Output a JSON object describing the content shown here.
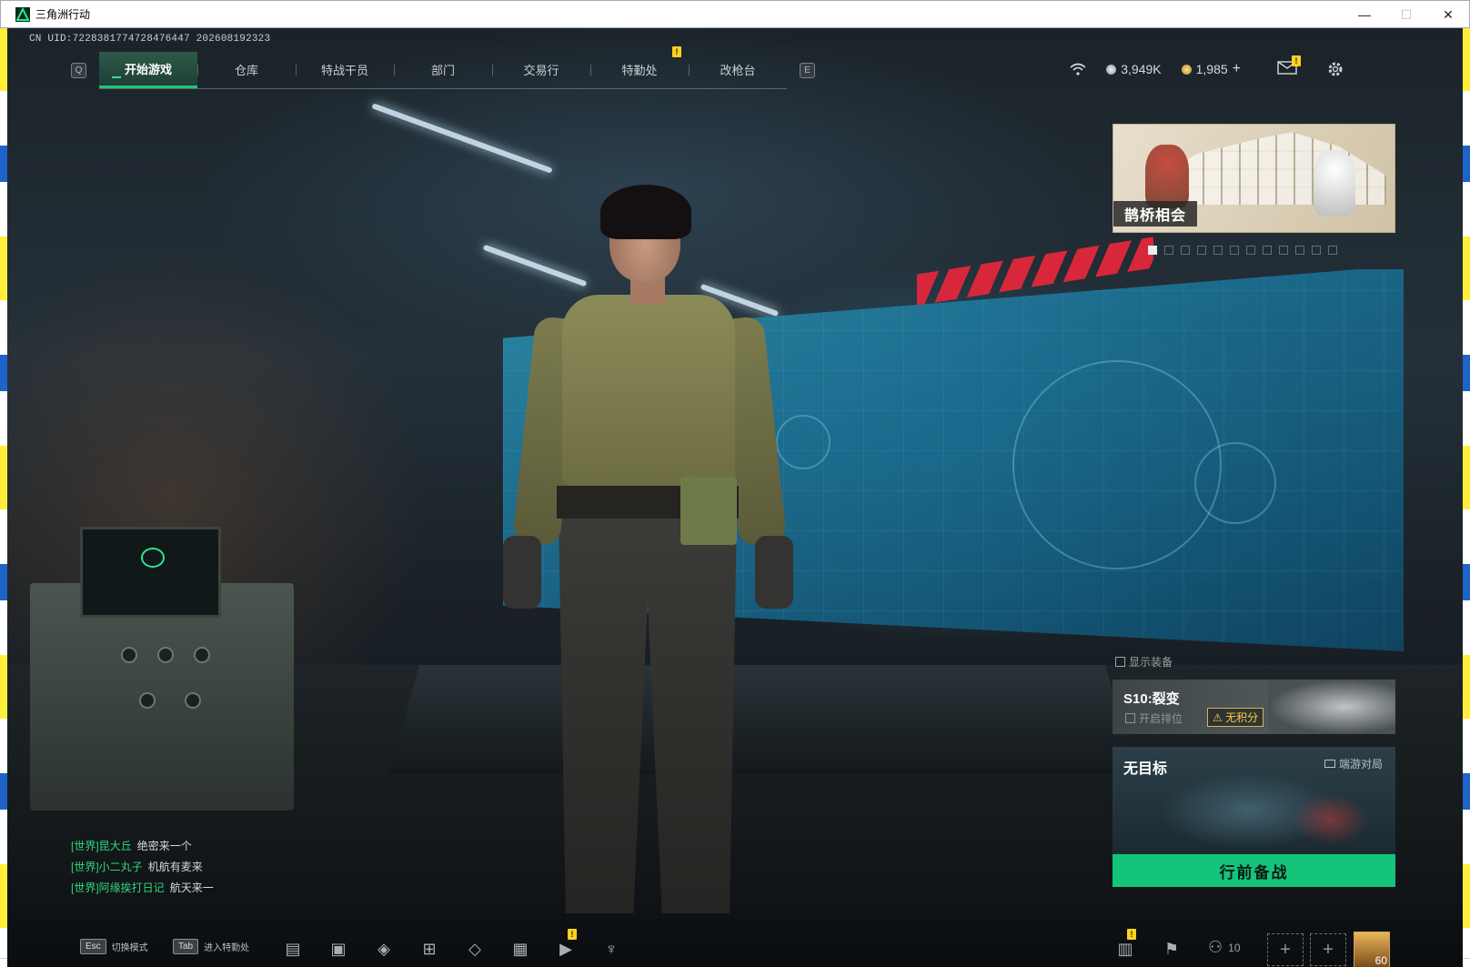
{
  "window": {
    "title": "三角洲行动",
    "minimize": "—",
    "maximize": "☐",
    "close": "✕"
  },
  "uid": "CN UID:7228381774728476447 202608192323",
  "nav": {
    "left_key": "Q",
    "right_key": "E",
    "tabs": [
      {
        "label": "开始游戏"
      },
      {
        "label": "仓库"
      },
      {
        "label": "特战干员"
      },
      {
        "label": "部门"
      },
      {
        "label": "交易行"
      },
      {
        "label": "特勤处"
      },
      {
        "label": "改枪台"
      }
    ],
    "alert": "!"
  },
  "currency": {
    "silver": "3,949K",
    "gold": "1,985",
    "add": "+"
  },
  "mail_alert": "!",
  "banner": {
    "label": "鹊桥相会"
  },
  "show_equipment": "显示装备",
  "season": {
    "title": "S10:裂变",
    "ranked": "开启排位",
    "warning": "无积分"
  },
  "map": {
    "title": "无目标",
    "mode": "端游对局"
  },
  "ready_button": "行前备战",
  "chat": [
    {
      "channel": "[世界]",
      "name": "昆大丘",
      "msg": "绝密来一个"
    },
    {
      "channel": "[世界]",
      "name": "小二丸子",
      "msg": "机航有麦来"
    },
    {
      "channel": "[世界]",
      "name": "阿缘挨打日记",
      "msg": "航天来一"
    }
  ],
  "bottom": {
    "esc_key": "Esc",
    "esc_label": "切换模式",
    "tab_key": "Tab",
    "tab_label": "进入特勤处",
    "friends_count": "10",
    "level": "60",
    "alert": "!"
  },
  "colors": {
    "accent_green": "#14c47b",
    "alert_yellow": "#ffd21f",
    "tab_active": "#24c47a"
  }
}
